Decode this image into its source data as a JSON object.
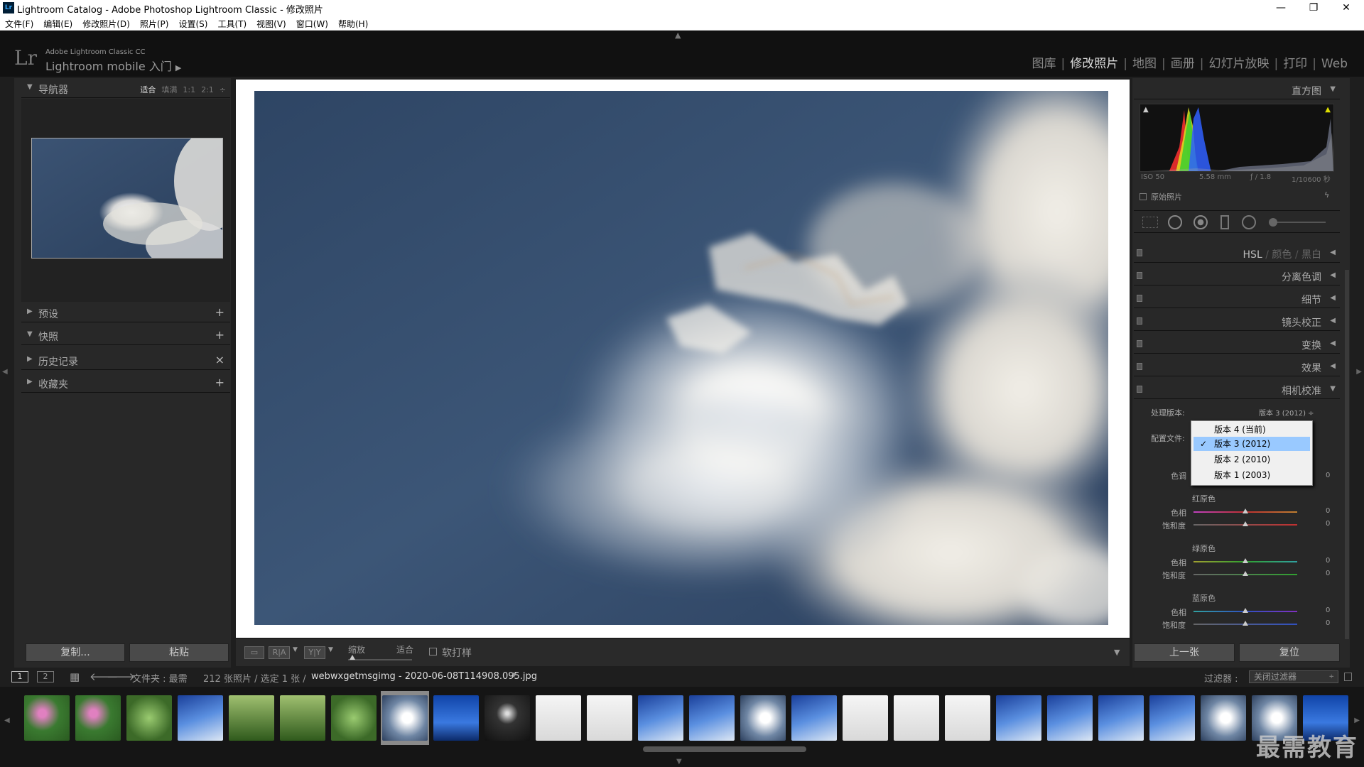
{
  "window": {
    "title": "Lightroom Catalog - Adobe Photoshop Lightroom Classic - 修改照片",
    "icon": "Lr"
  },
  "menu": [
    "文件(F)",
    "编辑(E)",
    "修改照片(D)",
    "照片(P)",
    "设置(S)",
    "工具(T)",
    "视图(V)",
    "窗口(W)",
    "帮助(H)"
  ],
  "identity": {
    "logo": "Lr",
    "product": "Adobe Lightroom Classic CC",
    "mobile": "Lightroom mobile 入门"
  },
  "modules": [
    {
      "label": "图库",
      "active": false
    },
    {
      "label": "修改照片",
      "active": true
    },
    {
      "label": "地图",
      "active": false
    },
    {
      "label": "画册",
      "active": false
    },
    {
      "label": "幻灯片放映",
      "active": false
    },
    {
      "label": "打印",
      "active": false
    },
    {
      "label": "Web",
      "active": false
    }
  ],
  "navigator": {
    "title": "导航器",
    "options": [
      "适合",
      "填满",
      "1:1",
      "2:1"
    ],
    "active_option": "适合"
  },
  "left_panels": [
    {
      "title": "预设",
      "action": "+"
    },
    {
      "title": "快照",
      "action": "+",
      "expanded": true
    },
    {
      "title": "历史记录",
      "action": "×"
    },
    {
      "title": "收藏夹",
      "action": "+"
    }
  ],
  "left_buttons": {
    "copy": "复制...",
    "paste": "粘贴"
  },
  "toolbar": {
    "zoom_label": "缩放",
    "fit_label": "适合",
    "softproof": "软打样"
  },
  "histogram": {
    "title": "直方图",
    "iso": "ISO 50",
    "focal": "5.58 mm",
    "aperture": "ƒ / 1.8",
    "shutter": "1/10600 秒",
    "original": "原始照片"
  },
  "right_panels": {
    "hsl": "HSL",
    "color": "颜色",
    "bw": "黑白",
    "split": "分离色调",
    "detail": "细节",
    "lens": "镜头校正",
    "transform": "变换",
    "effects": "效果",
    "calibration": "相机校准"
  },
  "calibration": {
    "process_label": "处理版本:",
    "process_value": "版本 3 (2012) ÷",
    "profile_label": "配置文件:",
    "tint_label": "色调",
    "tint_value": "0",
    "red": {
      "title": "红原色",
      "hue": "色相",
      "sat": "饱和度",
      "hue_v": "0",
      "sat_v": "0"
    },
    "green": {
      "title": "绿原色",
      "hue": "色相",
      "sat": "饱和度",
      "hue_v": "0",
      "sat_v": "0"
    },
    "blue": {
      "title": "蓝原色",
      "hue": "色相",
      "sat": "饱和度",
      "hue_v": "0",
      "sat_v": "0"
    }
  },
  "dropdown": {
    "options": [
      "版本 4 (当前)",
      "版本 3 (2012)",
      "版本 2 (2010)",
      "版本 1 (2003)"
    ],
    "selected_index": 1
  },
  "right_buttons": {
    "prev": "上一张",
    "reset": "复位"
  },
  "filmbar": {
    "page1": "1",
    "page2": "2",
    "folder": "文件夹 : 最需",
    "count": "212 张照片 / 选定 1 张 /",
    "filename": "webwxgetmsgimg - 2020-06-08T114908.095.jpg",
    "filter_label": "过滤器 :",
    "filter_value": "关闭过滤器"
  },
  "watermark": "最需教育",
  "colors": {
    "accent_select": "#99c9ff",
    "panel": "#282828",
    "bg": "#1e1e1e"
  },
  "film_thumbs": [
    "flowers",
    "flowers",
    "leaves",
    "sky",
    "trees",
    "trees",
    "leaves",
    "clouds",
    "building",
    "dark",
    "tree",
    "tree",
    "sky",
    "sky",
    "clouds",
    "sky",
    "tree",
    "tree",
    "tree",
    "sky",
    "sky",
    "sky",
    "sky",
    "clouds",
    "clouds",
    "building"
  ]
}
